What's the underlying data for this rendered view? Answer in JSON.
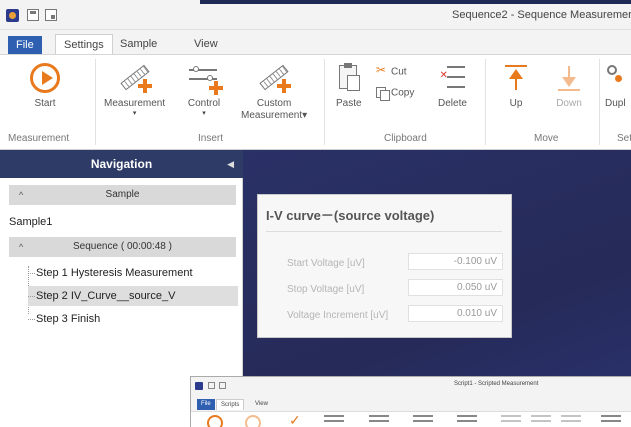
{
  "window": {
    "title": "Sequence2 - Sequence Measuremer"
  },
  "ribbon": {
    "tabs": [
      {
        "label": "File"
      },
      {
        "label": "Settings"
      },
      {
        "label": "Sample"
      },
      {
        "label": "View"
      }
    ],
    "buttons": {
      "start": "Start",
      "measurement": "Measurement",
      "control": "Control",
      "custom_line1": "Custom",
      "custom_line2": "Measurement",
      "paste": "Paste",
      "cut": "Cut",
      "copy": "Copy",
      "delete": "Delete",
      "up": "Up",
      "down": "Down",
      "duplicate": "Dupl"
    },
    "groups": {
      "measurement": "Measurement",
      "insert": "Insert",
      "clipboard": "Clipboard",
      "move": "Move",
      "partial": "Set"
    }
  },
  "navigation": {
    "title": "Navigation",
    "sample_section": "Sample",
    "sample_name": "Sample1",
    "sequence_section": "Sequence ( 00:00:48 )",
    "steps": [
      {
        "label": "Step 1 Hysteresis Measurement"
      },
      {
        "label": "Step 2 IV_Curve__source_V"
      },
      {
        "label": "Step 3 Finish"
      }
    ]
  },
  "card": {
    "title": "I-V curve－(source voltage)",
    "fields": [
      {
        "label": "Start Voltage [uV]",
        "value": "-0.100 uV"
      },
      {
        "label": "Stop Voltage [uV]",
        "value": "0.050 uV"
      },
      {
        "label": "Voltage Increment [uV]",
        "value": "0.010 uV"
      }
    ]
  },
  "script_window": {
    "title": "Script1 - Scripted Measurement",
    "tabs": [
      {
        "label": "File"
      },
      {
        "label": "Scripts"
      },
      {
        "label": "View"
      }
    ]
  },
  "colors": {
    "accent": "#e87a1d",
    "file_tab": "#2e5fb0",
    "nav_header": "#2d3b66",
    "main_bg": "#2a3166"
  }
}
